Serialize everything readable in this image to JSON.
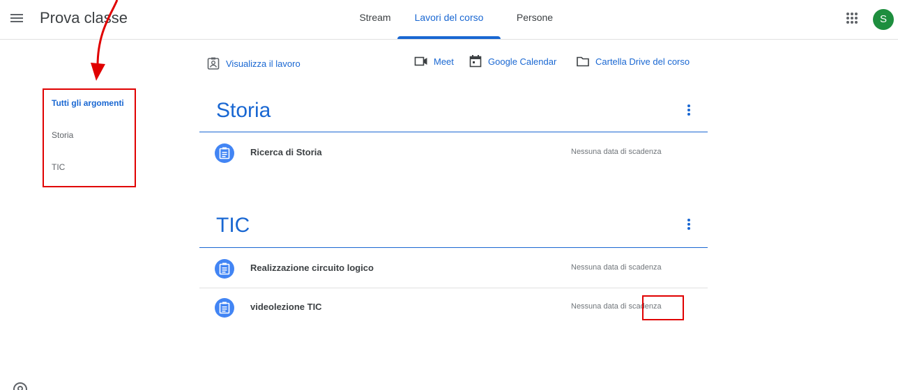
{
  "header": {
    "class_name": "Prova classe",
    "tabs": [
      {
        "label": "Stream"
      },
      {
        "label": "Lavori del corso"
      },
      {
        "label": "Persone"
      }
    ],
    "avatar_initial": "S"
  },
  "sidebar": {
    "topics": [
      {
        "label": "Tutti gli argomenti"
      },
      {
        "label": "Storia"
      },
      {
        "label": "TIC"
      }
    ]
  },
  "actions": {
    "view_work": "Visualizza il lavoro",
    "meet": "Meet",
    "calendar": "Google Calendar",
    "drive": "Cartella Drive del corso"
  },
  "sections": [
    {
      "title": "Storia",
      "items": [
        {
          "title": "Ricerca di Storia",
          "due": "Nessuna data di scadenza"
        }
      ]
    },
    {
      "title": "TIC",
      "items": [
        {
          "title": "Realizzazione circuito logico",
          "due": "Nessuna data di scadenza"
        },
        {
          "title": "videolezione TIC",
          "due": "Nessuna data di scadenza"
        }
      ]
    }
  ],
  "colors": {
    "accent": "#1967d2",
    "annotation": "#e00000",
    "avatar": "#1e8e3e",
    "item_icon": "#4285f4"
  },
  "icons": [
    "menu-icon",
    "apps-icon",
    "assignment-icon",
    "video-icon",
    "calendar-icon",
    "folder-icon",
    "help-icon"
  ]
}
